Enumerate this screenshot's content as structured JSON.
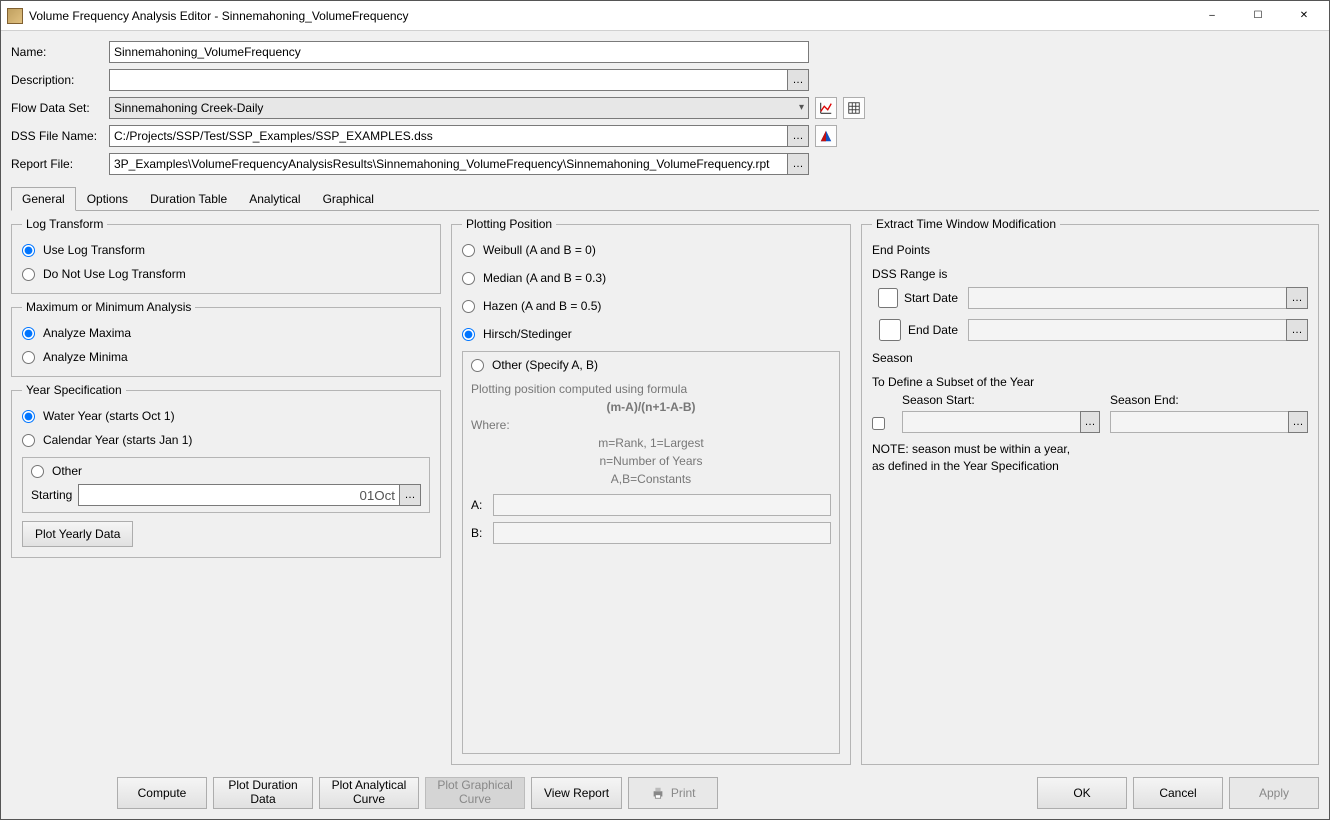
{
  "window": {
    "title": "Volume Frequency Analysis Editor - Sinnemahoning_VolumeFrequency"
  },
  "fields": {
    "name_label": "Name:",
    "name_value": "Sinnemahoning_VolumeFrequency",
    "desc_label": "Description:",
    "desc_value": "",
    "flow_label": "Flow Data Set:",
    "flow_value": "Sinnemahoning Creek-Daily",
    "dss_label": "DSS File Name:",
    "dss_value": "C:/Projects/SSP/Test/SSP_Examples/SSP_EXAMPLES.dss",
    "report_label": "Report File:",
    "report_value": "3P_Examples\\VolumeFrequencyAnalysisResults\\Sinnemahoning_VolumeFrequency\\Sinnemahoning_VolumeFrequency.rpt"
  },
  "tabs": {
    "general": "General",
    "options": "Options",
    "duration_table": "Duration Table",
    "analytical": "Analytical",
    "graphical": "Graphical"
  },
  "log_transform": {
    "legend": "Log Transform",
    "use": "Use Log Transform",
    "dont": "Do Not Use Log Transform"
  },
  "max_min": {
    "legend": "Maximum or Minimum Analysis",
    "max": "Analyze Maxima",
    "min": "Analyze Minima"
  },
  "year_spec": {
    "legend": "Year Specification",
    "water": "Water Year (starts Oct 1)",
    "calendar": "Calendar Year (starts Jan 1)",
    "other": "Other",
    "starting_label": "Starting",
    "starting_value": "01Oct",
    "plot_btn": "Plot Yearly Data"
  },
  "plotting": {
    "legend": "Plotting Position",
    "weibull": "Weibull (A and B = 0)",
    "median": "Median (A and B = 0.3)",
    "hazen": "Hazen (A and B = 0.5)",
    "hirsch": "Hirsch/Stedinger",
    "other": "Other (Specify A, B)",
    "formula_intro": "Plotting position computed using formula",
    "formula": "(m-A)/(n+1-A-B)",
    "where": "Where:",
    "line_m": "m=Rank, 1=Largest",
    "line_n": "n=Number of Years",
    "line_ab": "A,B=Constants",
    "A_label": "A:",
    "B_label": "B:"
  },
  "extract": {
    "legend": "Extract Time Window Modification",
    "end_points": "End Points",
    "dss_range": "DSS Range is",
    "start_date": "Start Date",
    "end_date": "End Date",
    "season": "Season",
    "subset": "To Define a Subset of the Year",
    "season_start": "Season Start:",
    "season_end": "Season End:",
    "note": "NOTE: season must be within a year,\nas defined in the Year Specification"
  },
  "footer": {
    "compute": "Compute",
    "plot_dur1": "Plot Duration",
    "plot_dur2": "Data",
    "plot_anal1": "Plot Analytical",
    "plot_anal2": "Curve",
    "plot_graph1": "Plot Graphical",
    "plot_graph2": "Curve",
    "view_report": "View Report",
    "print": "Print",
    "ok": "OK",
    "cancel": "Cancel",
    "apply": "Apply"
  }
}
